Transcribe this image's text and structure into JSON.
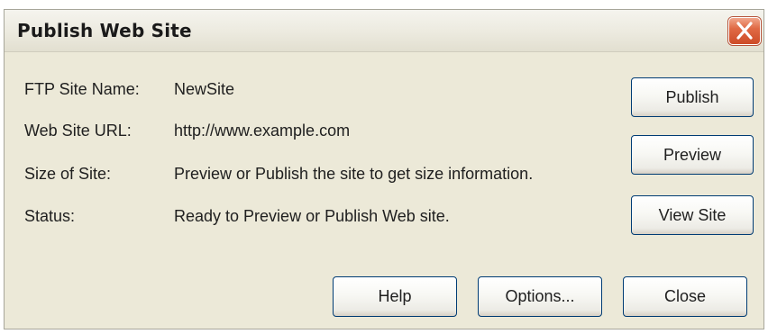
{
  "window": {
    "title": "Publish Web Site",
    "close_icon": "close-x-icon"
  },
  "info": {
    "ftp_label": "FTP Site Name:",
    "ftp_value": "NewSite",
    "url_label": "Web Site URL:",
    "url_value": "http://www.example.com",
    "size_label": "Size of Site:",
    "size_value": "Preview or Publish the site to get size information.",
    "status_label": "Status:",
    "status_value": "Ready to Preview or Publish Web site."
  },
  "buttons": {
    "publish": "Publish",
    "preview": "Preview",
    "view_site": "View Site",
    "help": "Help",
    "options": "Options...",
    "close": "Close"
  },
  "colors": {
    "dialog_bg": "#ece9d8",
    "close_button": "#d9562f",
    "button_border": "#003c74"
  }
}
